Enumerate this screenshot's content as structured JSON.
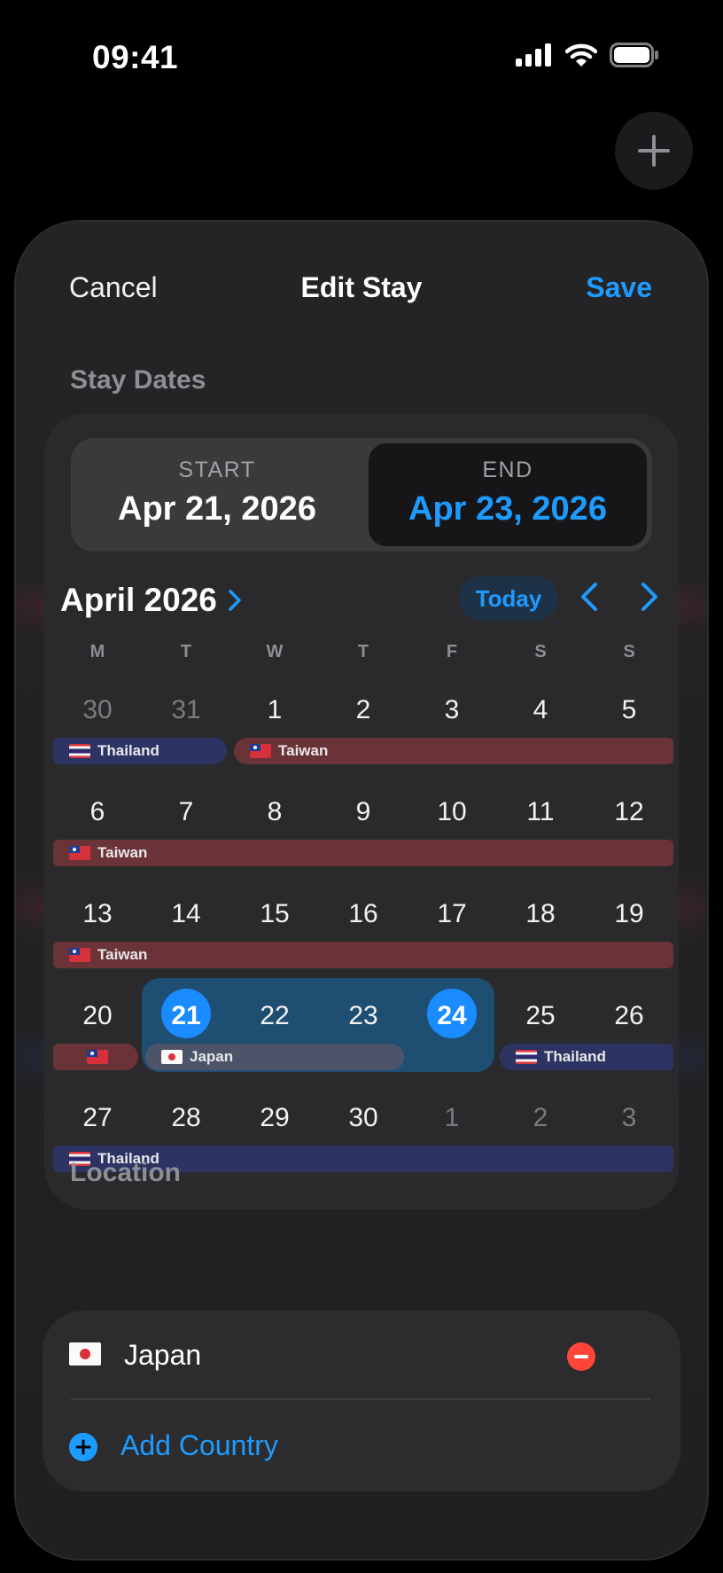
{
  "status_bar": {
    "time": "09:41",
    "signal_icon": "cellular-signal-icon",
    "wifi_icon": "wifi-icon",
    "battery_icon": "battery-icon"
  },
  "fab": {
    "icon": "plus-icon"
  },
  "sheet": {
    "cancel_label": "Cancel",
    "title": "Edit Stay",
    "save_label": "Save",
    "accent_color": "#1e9bff"
  },
  "stay_dates": {
    "section_label": "Stay Dates",
    "start_caption": "START",
    "start_value": "Apr 21, 2026",
    "end_caption": "END",
    "end_value": "Apr 23, 2026"
  },
  "calendar": {
    "month_label": "April 2026",
    "today_label": "Today",
    "weekdays": [
      "M",
      "T",
      "W",
      "T",
      "F",
      "S",
      "S"
    ],
    "weeks": [
      [
        "30",
        "31",
        "1",
        "2",
        "3",
        "4",
        "5"
      ],
      [
        "6",
        "7",
        "8",
        "9",
        "10",
        "11",
        "12"
      ],
      [
        "13",
        "14",
        "15",
        "16",
        "17",
        "18",
        "19"
      ],
      [
        "20",
        "21",
        "22",
        "23",
        "24",
        "25",
        "26"
      ],
      [
        "27",
        "28",
        "29",
        "30",
        "1",
        "2",
        "3"
      ]
    ],
    "stays": {
      "thailand": "Thailand",
      "taiwan": "Taiwan",
      "japan": "Japan"
    },
    "colors": {
      "taiwan": "#6a3338",
      "thailand": "#2d3463",
      "japan": "#4b5468",
      "selection": "#1a8cff"
    }
  },
  "location": {
    "section_label": "Location",
    "country": "Japan",
    "add_label": "Add Country"
  }
}
